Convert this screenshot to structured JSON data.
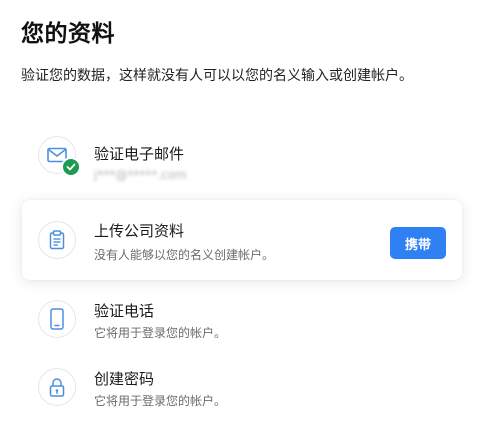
{
  "page": {
    "title": "您的资料",
    "subtitle": "验证您的数据，这样就没有人可以以您的名义输入或创建帐户。"
  },
  "steps": [
    {
      "title": "验证电子邮件",
      "detail": "j***@*****.com",
      "icon": "envelope-icon",
      "verified": true
    },
    {
      "title": "上传公司资料",
      "detail": "没有人能够以您的名义创建帐户。",
      "icon": "clipboard-icon",
      "action_label": "携带",
      "highlighted": true
    },
    {
      "title": "验证电话",
      "detail": "它将用于登录您的帐户。",
      "icon": "phone-icon"
    },
    {
      "title": "创建密码",
      "detail": "它将用于登录您的帐户。",
      "icon": "lock-icon"
    }
  ],
  "colors": {
    "accent": "#2f80f2",
    "success": "#1e9b4f",
    "icon_stroke": "#4a90e2"
  }
}
